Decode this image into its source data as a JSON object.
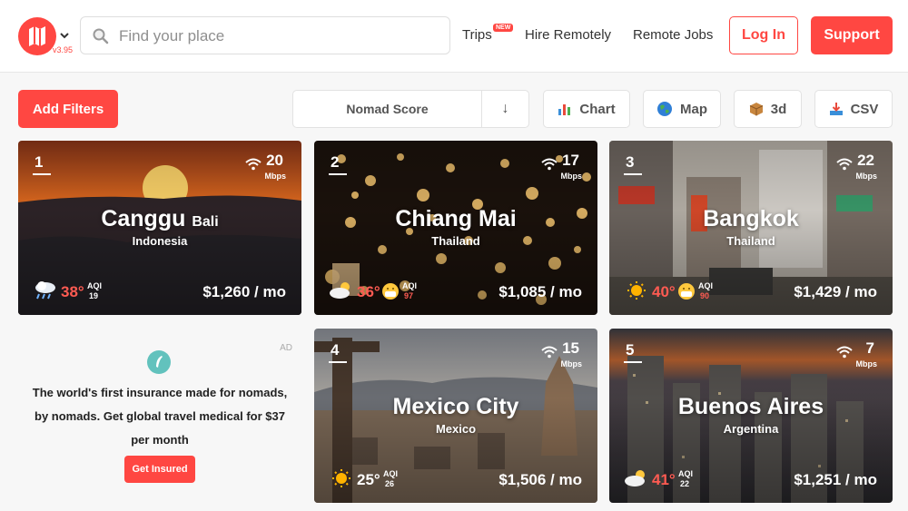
{
  "header": {
    "version": "v3.95",
    "search_placeholder": "Find your place",
    "nav": {
      "trips": "Trips",
      "new_badge": "NEW",
      "hire_remotely": "Hire Remotely",
      "remote_jobs": "Remote Jobs"
    },
    "login_label": "Log In",
    "support_label": "Support"
  },
  "toolbar": {
    "add_filters": "Add Filters",
    "sort_by": "Nomad Score",
    "sort_direction": "↓",
    "chart": "Chart",
    "map": "Map",
    "three_d": "3d",
    "csv": "CSV"
  },
  "cards": [
    {
      "rank": "1",
      "city": "Canggu",
      "city_sub": "Bali",
      "country": "Indonesia",
      "internet": "20",
      "internet_unit": "Mbps",
      "weather_icon": "rain-cloud-icon",
      "temp": "38°",
      "aqi_label": "AQI",
      "aqi": "19",
      "cost": "$1,260 / mo"
    },
    {
      "rank": "2",
      "city": "Chiang Mai",
      "city_sub": "",
      "country": "Thailand",
      "internet": "17",
      "internet_unit": "Mbps",
      "weather_icon": "partly-cloudy-icon",
      "temp": "36°",
      "aqi_label": "AQI",
      "aqi": "97",
      "cost": "$1,085 / mo"
    },
    {
      "rank": "3",
      "city": "Bangkok",
      "city_sub": "",
      "country": "Thailand",
      "internet": "22",
      "internet_unit": "Mbps",
      "weather_icon": "sun-icon",
      "temp": "40°",
      "aqi_label": "AQI",
      "aqi": "90",
      "cost": "$1,429 / mo"
    },
    {
      "rank": "4",
      "city": "Mexico City",
      "city_sub": "",
      "country": "Mexico",
      "internet": "15",
      "internet_unit": "Mbps",
      "weather_icon": "sun-icon",
      "temp": "25°",
      "aqi_label": "AQI",
      "aqi": "26",
      "cost": "$1,506 / mo"
    },
    {
      "rank": "5",
      "city": "Buenos Aires",
      "city_sub": "",
      "country": "Argentina",
      "internet": "7",
      "internet_unit": "Mbps",
      "weather_icon": "partly-cloudy-icon",
      "temp": "41°",
      "aqi_label": "AQI",
      "aqi": "22",
      "cost": "$1,251 / mo"
    }
  ],
  "ad": {
    "label": "AD",
    "line1": "The world's first insurance made for nomads,",
    "line2": "by nomads. Get global travel medical for $37",
    "line3": "per month",
    "button": "Get Insured"
  },
  "colors": {
    "brand": "#ff4742",
    "hot": "#ff5b52"
  }
}
